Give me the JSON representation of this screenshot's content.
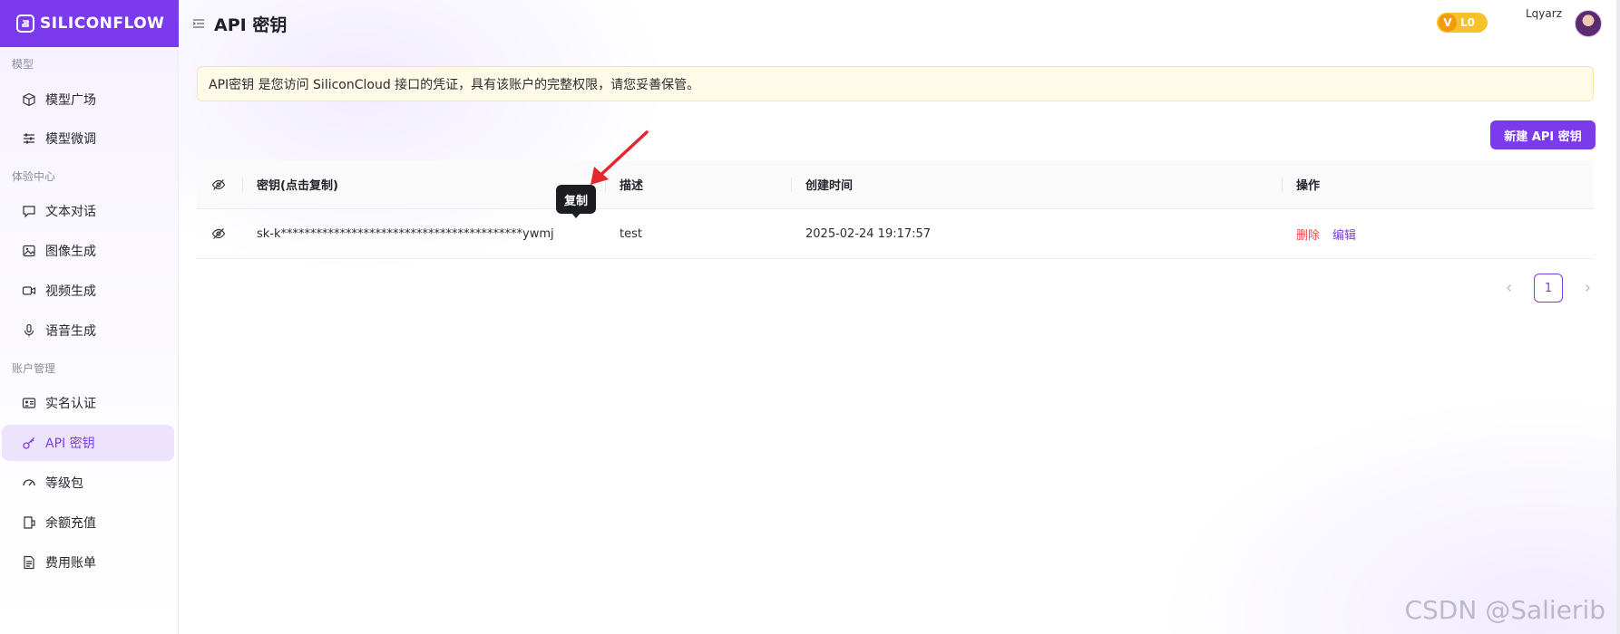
{
  "brand": {
    "name": "SILICONFLOW"
  },
  "sidebar": {
    "sections": [
      {
        "title": "模型",
        "items": [
          {
            "label": "模型广场",
            "icon": "cube-icon"
          },
          {
            "label": "模型微调",
            "icon": "sliders-icon"
          }
        ]
      },
      {
        "title": "体验中心",
        "items": [
          {
            "label": "文本对话",
            "icon": "chat-icon"
          },
          {
            "label": "图像生成",
            "icon": "image-icon"
          },
          {
            "label": "视频生成",
            "icon": "video-icon"
          },
          {
            "label": "语音生成",
            "icon": "mic-icon"
          }
        ]
      },
      {
        "title": "账户管理",
        "items": [
          {
            "label": "实名认证",
            "icon": "id-card-icon"
          },
          {
            "label": "API 密钥",
            "icon": "key-icon",
            "active": true
          },
          {
            "label": "等级包",
            "icon": "gauge-icon"
          },
          {
            "label": "余额充值",
            "icon": "wallet-icon"
          },
          {
            "label": "费用账单",
            "icon": "bill-icon"
          }
        ]
      }
    ]
  },
  "header": {
    "title": "API 密钥",
    "level": "L0",
    "level_letter": "V",
    "username": "Lqyarz"
  },
  "notice": "API密钥 是您访问 SiliconCloud 接口的凭证，具有该账户的完整权限，请您妥善保管。",
  "actions": {
    "new_key": "新建 API 密钥"
  },
  "table": {
    "columns": [
      "密钥(点击复制)",
      "描述",
      "创建时间",
      "操作"
    ],
    "rows": [
      {
        "key": "sk-k*****************************************ywmj",
        "description": "test",
        "created": "2025-02-24 19:17:57",
        "delete": "删除",
        "edit": "编辑"
      }
    ]
  },
  "tooltip": "复制",
  "pagination": {
    "current": "1"
  },
  "watermark": "CSDN @Salierib",
  "colors": {
    "accent": "#7c3aed",
    "danger": "#f5484a",
    "notice_bg": "#fffbe8",
    "annotation": "#e5262e"
  }
}
